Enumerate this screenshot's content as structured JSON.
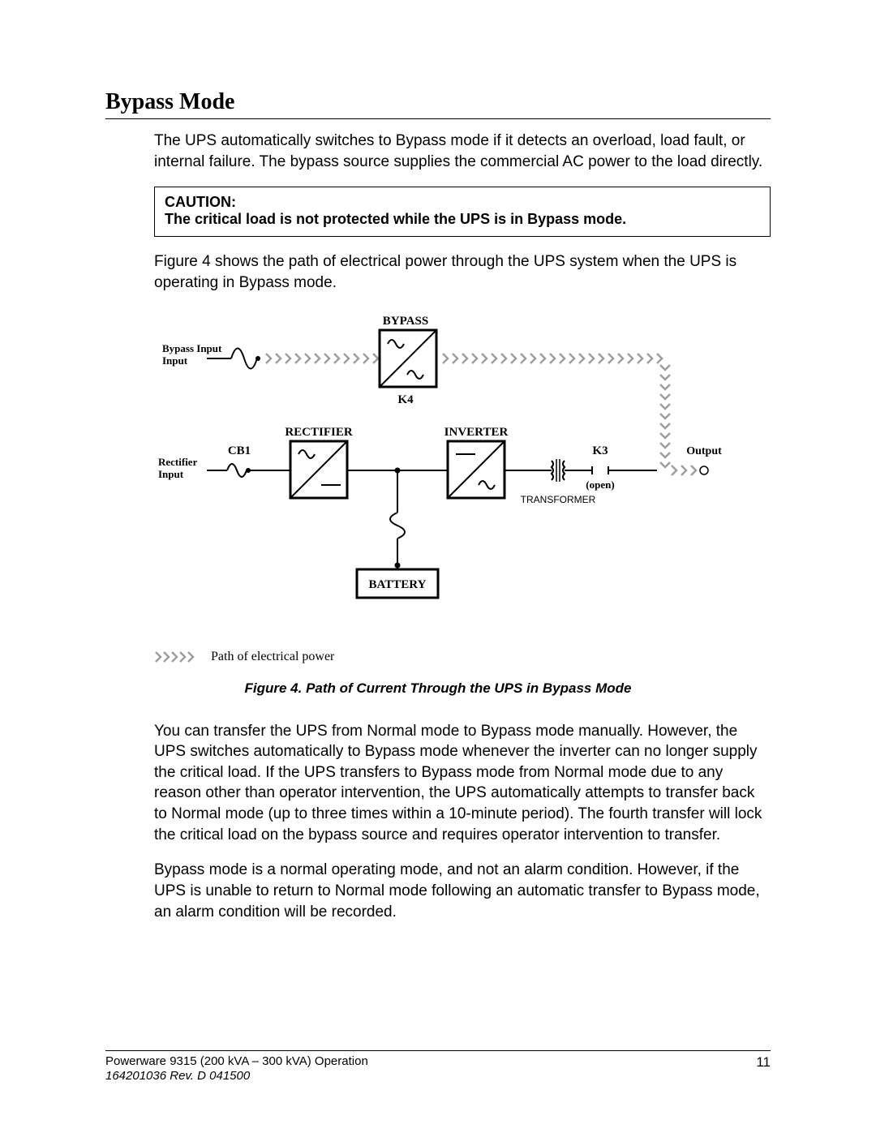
{
  "section_title": "Bypass Mode",
  "para_intro": "The UPS automatically switches to Bypass mode if it detects an overload, load fault, or internal failure.  The bypass source supplies the commercial AC power to the load directly.",
  "caution": {
    "label": "CAUTION:",
    "text": "The critical load is not protected while the UPS is in Bypass mode."
  },
  "para_fig_intro": "Figure 4 shows the path of electrical power through the UPS system when the UPS is operating in Bypass mode.",
  "diagram": {
    "bypass_label": "BYPASS",
    "k4_label": "K4",
    "bypass_input": "Bypass Input",
    "rectifier_label": "RECTIFIER",
    "inverter_label": "INVERTER",
    "cb1_label": "CB1",
    "rectifier_input": "Rectifier Input",
    "k3_label": "K3",
    "output_label": "Output",
    "open_label": "(open)",
    "transformer_label": "TRANSFORMER",
    "battery_label": "BATTERY"
  },
  "legend_text": "Path of electrical power",
  "figure_caption": "Figure 4.  Path of Current Through the UPS in Bypass Mode",
  "para_transfer": "You can transfer the UPS from Normal mode to Bypass mode manually.  However, the UPS switches automatically to Bypass mode whenever the inverter can no longer supply the critical load.  If the UPS transfers to Bypass mode from Normal mode due to any reason other than operator intervention, the UPS automatically attempts to transfer back to Normal mode (up to three times within a 10-minute period).  The fourth transfer will lock the critical load on the bypass source and requires operator intervention to transfer.",
  "para_alarm": "Bypass mode is a normal operating mode, and not an alarm condition.  However, if the UPS is unable to return to Normal mode following an automatic transfer to Bypass mode, an alarm condition will be recorded.",
  "footer": {
    "product": "Powerware 9315 (200 kVA – 300 kVA) Operation",
    "docnum": "164201036  Rev. D  041500",
    "page": "11"
  }
}
